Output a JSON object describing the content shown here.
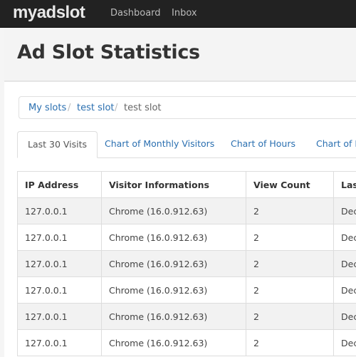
{
  "navbar": {
    "brand": "myadslot",
    "links": [
      "Dashboard",
      "Inbox"
    ]
  },
  "header": {
    "title": "Ad Slot Statistics"
  },
  "breadcrumb": {
    "items": [
      "My slots",
      "test slot",
      "test slot"
    ],
    "separator": "/"
  },
  "tabs": [
    {
      "label": "Last 30 Visits",
      "active": true
    },
    {
      "label": "Chart of Monthly Visitors"
    },
    {
      "label": "Chart of Hours"
    },
    {
      "label": "Chart of B"
    }
  ],
  "table": {
    "headers": [
      "IP Address",
      "Visitor Informations",
      "View Count",
      "Las"
    ],
    "rows": [
      [
        "127.0.0.1",
        "Chrome (16.0.912.63)",
        "2",
        "Dec"
      ],
      [
        "127.0.0.1",
        "Chrome (16.0.912.63)",
        "2",
        "Dec"
      ],
      [
        "127.0.0.1",
        "Chrome (16.0.912.63)",
        "2",
        "Dec"
      ],
      [
        "127.0.0.1",
        "Chrome (16.0.912.63)",
        "2",
        "Dec"
      ],
      [
        "127.0.0.1",
        "Chrome (16.0.912.63)",
        "2",
        "Dec"
      ],
      [
        "127.0.0.1",
        "Chrome (16.0.912.63)",
        "2",
        "Dec"
      ]
    ]
  },
  "colors": {
    "navbar_bg": "#222222",
    "link": "#2a6fb0",
    "striped_row": "#f2f2f2"
  }
}
